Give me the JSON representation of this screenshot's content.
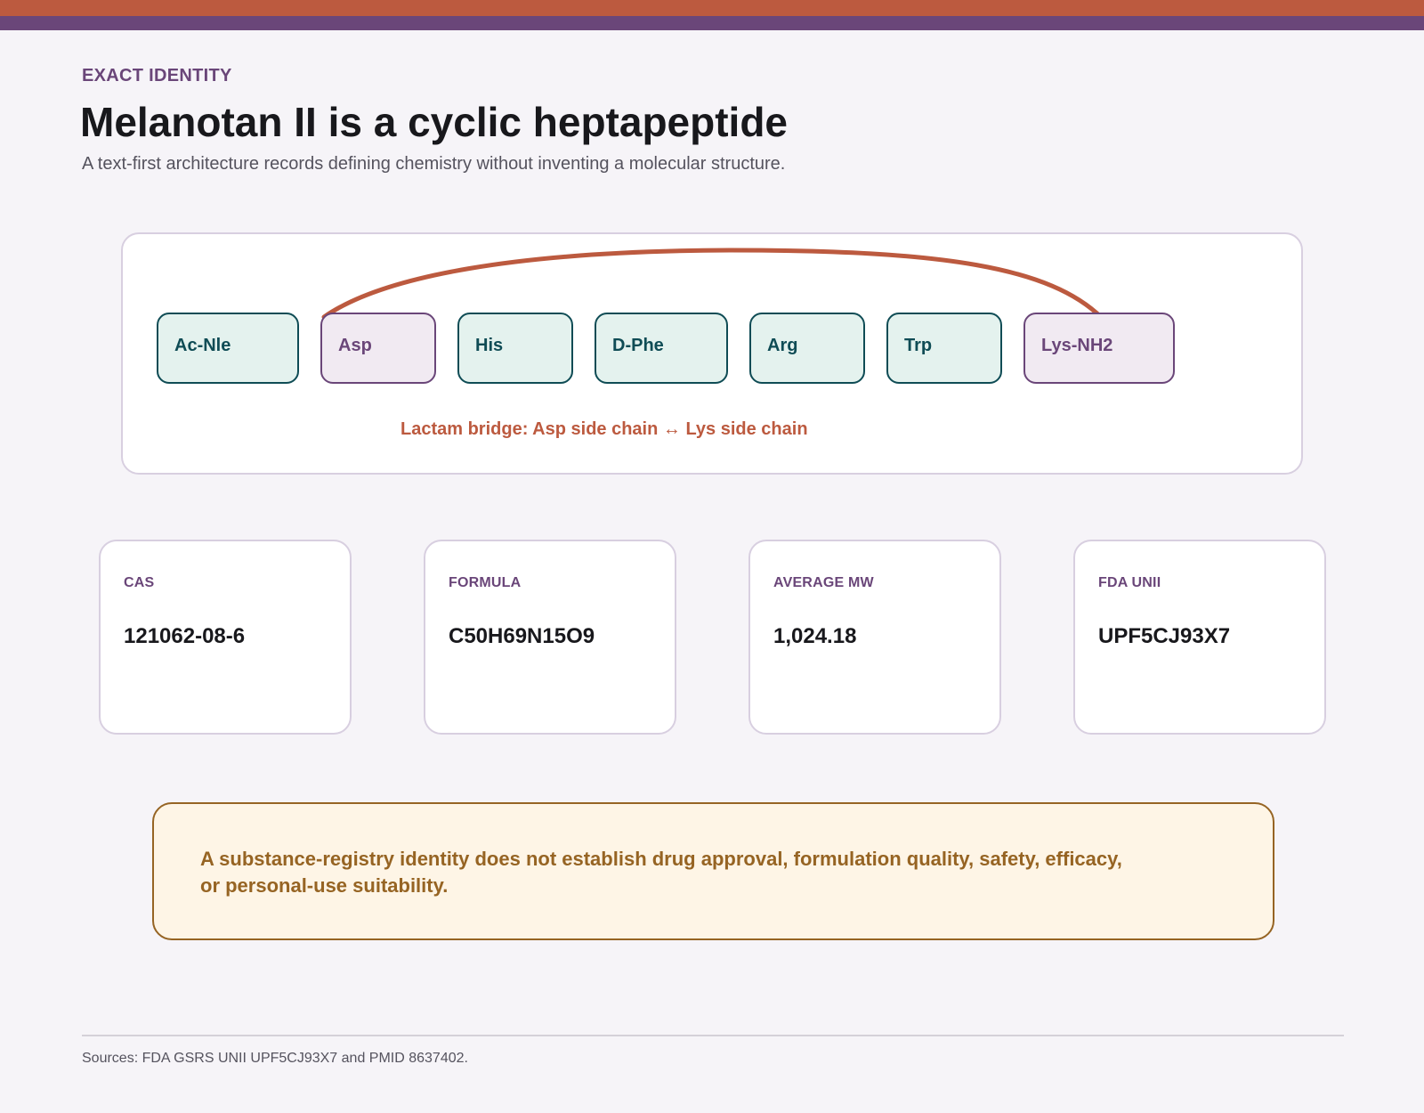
{
  "header": {
    "eyebrow": "EXACT IDENTITY",
    "title": "Melanotan II is a cyclic heptapeptide",
    "subtitle": "A text-first architecture records defining chemistry without inventing a molecular structure."
  },
  "sequence": {
    "residues": [
      {
        "label": "Ac-Nle",
        "style": "teal"
      },
      {
        "label": "Asp",
        "style": "purple"
      },
      {
        "label": "His",
        "style": "teal"
      },
      {
        "label": "D-Phe",
        "style": "teal"
      },
      {
        "label": "Arg",
        "style": "teal"
      },
      {
        "label": "Trp",
        "style": "teal"
      },
      {
        "label": "Lys-NH2",
        "style": "purple"
      }
    ],
    "bridge": {
      "from": "Asp",
      "to": "Lys-NH2",
      "label": "Lactam bridge: Asp side chain ↔ Lys side chain"
    }
  },
  "identity": {
    "cas": {
      "label": "CAS",
      "value": "121062-08-6"
    },
    "formula": {
      "label": "FORMULA",
      "value": "C50H69N15O9"
    },
    "mw": {
      "label": "AVERAGE MW",
      "value": "1,024.18"
    },
    "unii": {
      "label": "FDA UNII",
      "value": "UPF5CJ93X7"
    }
  },
  "notice": {
    "text": "A substance-registry identity does not establish drug approval, formulation quality, safety, efficacy, or personal-use suitability."
  },
  "footer": {
    "sources": "Sources: FDA GSRS UNII UPF5CJ93X7 and PMID 8637402."
  },
  "colors": {
    "accent_orange": "#bc5a3f",
    "accent_purple": "#6a4679",
    "teal": "#0f4c55",
    "teal_fill": "#e4f2ee",
    "purple_fill": "#f1eaf2",
    "warning_gold": "#966423",
    "warning_fill": "#fef5e6"
  }
}
